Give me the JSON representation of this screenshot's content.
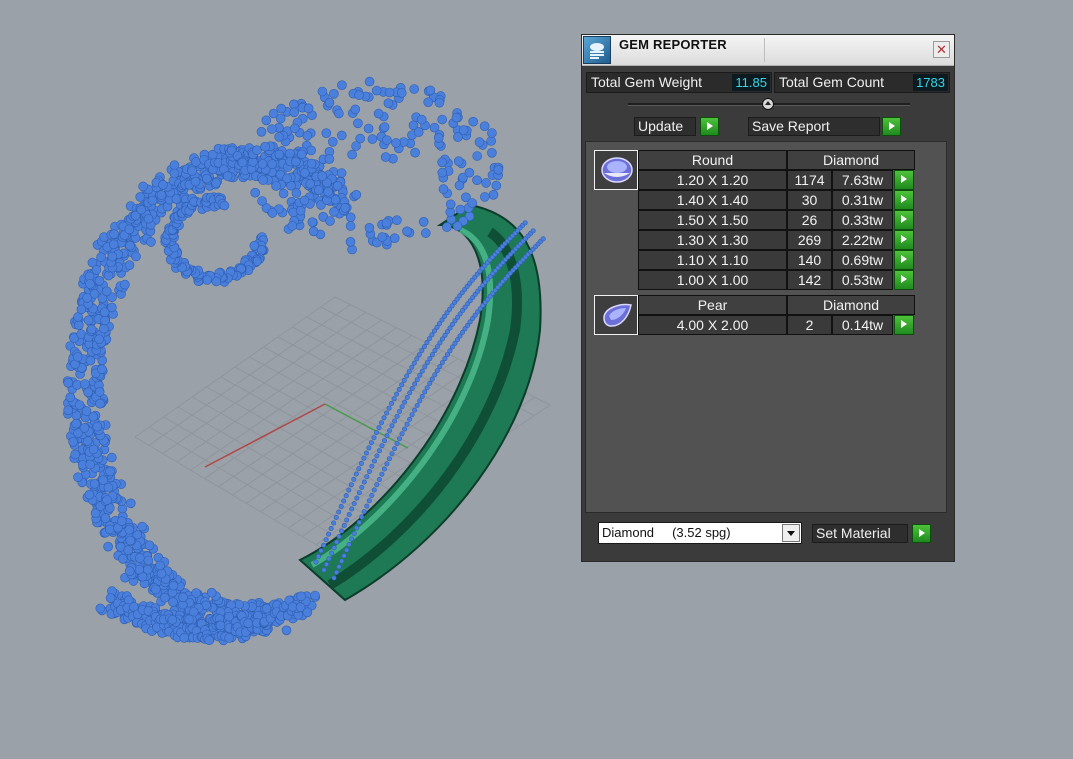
{
  "window": {
    "title": "GEM REPORTER",
    "close_glyph": "✕",
    "icon": "app-icon"
  },
  "summary": {
    "weight_label": "Total Gem Weight",
    "weight_value": "11.85",
    "count_label": "Total Gem Count",
    "count_value": "1783"
  },
  "actions": {
    "update_label": "Update",
    "save_label": "Save Report"
  },
  "groups": [
    {
      "shape": "Round",
      "material": "Diamond",
      "rows": [
        {
          "size": "1.20 X 1.20",
          "count": "1174",
          "weight": "7.63tw"
        },
        {
          "size": "1.40 X 1.40",
          "count": "30",
          "weight": "0.31tw"
        },
        {
          "size": "1.50 X 1.50",
          "count": "26",
          "weight": "0.33tw"
        },
        {
          "size": "1.30 X 1.30",
          "count": "269",
          "weight": "2.22tw"
        },
        {
          "size": "1.10 X 1.10",
          "count": "140",
          "weight": "0.69tw"
        },
        {
          "size": "1.00 X 1.00",
          "count": "142",
          "weight": "0.53tw"
        }
      ]
    },
    {
      "shape": "Pear",
      "material": "Diamond",
      "rows": [
        {
          "size": "4.00 X 2.00",
          "count": "2",
          "weight": "0.14tw"
        }
      ]
    }
  ],
  "material": {
    "selected": "Diamond     (3.52 spg)",
    "set_label": "Set Material"
  },
  "colors": {
    "viewport_bg": "#9aa1a9",
    "gem_blue": "#4a7fdc",
    "metal_green": "#1e7a55",
    "panel_bg": "#3b3b3b",
    "value_cyan": "#37d7e6",
    "play_green": "#2fa52f"
  }
}
